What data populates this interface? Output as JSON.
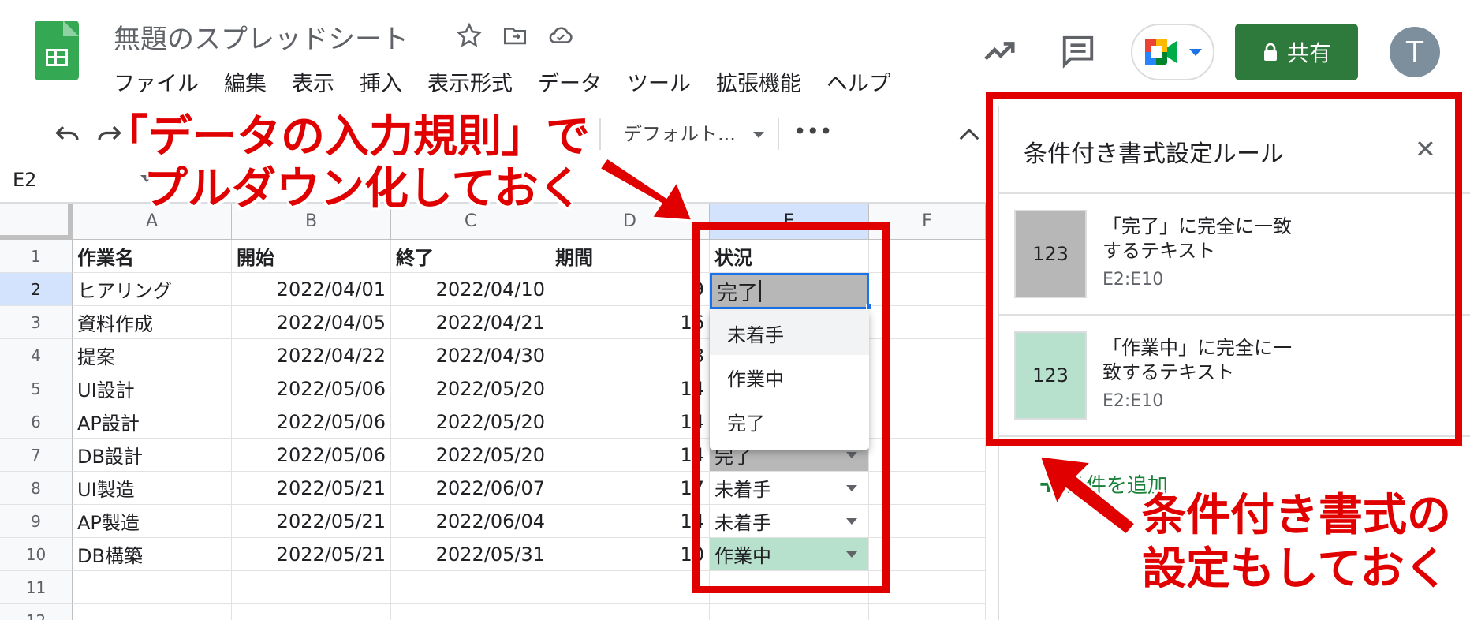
{
  "header": {
    "doc_title": "無題のスプレッドシート",
    "menu": [
      "ファイル",
      "編集",
      "表示",
      "挿入",
      "表示形式",
      "データ",
      "ツール",
      "拡張機能",
      "ヘルプ"
    ],
    "share_label": "共有",
    "avatar_letter": "T"
  },
  "toolbar": {
    "font_name": "デフォルト...",
    "more_label": "•••"
  },
  "name_box": "E2",
  "columns": [
    "A",
    "B",
    "C",
    "D",
    "E",
    "F"
  ],
  "rows": [
    {
      "num": "1",
      "a": "作業名",
      "b": "開始",
      "c": "終了",
      "d": "期間",
      "e": "状況"
    },
    {
      "num": "2",
      "a": "ヒアリング",
      "b": "2022/04/01",
      "c": "2022/04/10",
      "d": "9",
      "e": "完了"
    },
    {
      "num": "3",
      "a": "資料作成",
      "b": "2022/04/05",
      "c": "2022/04/21",
      "d": "16",
      "e": ""
    },
    {
      "num": "4",
      "a": "提案",
      "b": "2022/04/22",
      "c": "2022/04/30",
      "d": "8",
      "e": ""
    },
    {
      "num": "5",
      "a": "UI設計",
      "b": "2022/05/06",
      "c": "2022/05/20",
      "d": "14",
      "e": ""
    },
    {
      "num": "6",
      "a": "AP設計",
      "b": "2022/05/06",
      "c": "2022/05/20",
      "d": "14",
      "e": ""
    },
    {
      "num": "7",
      "a": "DB設計",
      "b": "2022/05/06",
      "c": "2022/05/20",
      "d": "14",
      "e": "完了"
    },
    {
      "num": "8",
      "a": "UI製造",
      "b": "2022/05/21",
      "c": "2022/06/07",
      "d": "17",
      "e": "未着手"
    },
    {
      "num": "9",
      "a": "AP製造",
      "b": "2022/05/21",
      "c": "2022/06/04",
      "d": "14",
      "e": "未着手"
    },
    {
      "num": "10",
      "a": "DB構築",
      "b": "2022/05/21",
      "c": "2022/05/31",
      "d": "10",
      "e": "作業中"
    },
    {
      "num": "11",
      "a": "",
      "b": "",
      "c": "",
      "d": "",
      "e": ""
    },
    {
      "num": "12",
      "a": "",
      "b": "",
      "c": "",
      "d": "",
      "e": ""
    }
  ],
  "active_cell_value": "完了",
  "dropdown_options": [
    "未着手",
    "作業中",
    "完了"
  ],
  "panel": {
    "title": "条件付き書式設定ルール",
    "rules": [
      {
        "swatch_text": "123",
        "line1": "「完了」に完全に一致",
        "line2": "するテキスト",
        "range": "E2:E10",
        "color": "#b7b7b7"
      },
      {
        "swatch_text": "123",
        "line1": "「作業中」に完全に一",
        "line2": "致するテキスト",
        "range": "E2:E10",
        "color": "#b7e1cd"
      }
    ],
    "add_rule_label": "条件を追加"
  },
  "annotations": {
    "note1_line1": "「データの入力規則」で",
    "note1_line2": "プルダウン化しておく",
    "note2_line1": "条件付き書式の",
    "note2_line2": "設定もしておく"
  },
  "colors": {
    "done": "#b7b7b7",
    "wip": "#b7e1cd",
    "share": "#2d7a3c",
    "annotation": "#e10000",
    "selection": "#1a73e8"
  }
}
